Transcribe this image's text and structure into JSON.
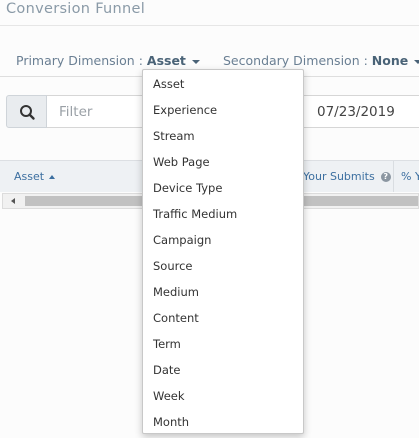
{
  "page": {
    "title": "Conversion Funnel"
  },
  "dimensions": {
    "primary_label": "Primary Dimension :",
    "primary_value": "Asset",
    "secondary_label": "Secondary Dimension :",
    "secondary_value": "None"
  },
  "search": {
    "placeholder": "Filter",
    "icon": "search-icon"
  },
  "date_range": {
    "value": "07/23/2019"
  },
  "table": {
    "columns": [
      {
        "label": "Asset",
        "sort": "ascending"
      },
      {
        "label": "Your Submits"
      },
      {
        "label": "% Y"
      }
    ]
  },
  "dropdown": {
    "options": [
      "Asset",
      "Experience",
      "Stream",
      "Web Page",
      "Device Type",
      "Traffic Medium",
      "Campaign",
      "Source",
      "Medium",
      "Content",
      "Term",
      "Date",
      "Week",
      "Month"
    ]
  }
}
